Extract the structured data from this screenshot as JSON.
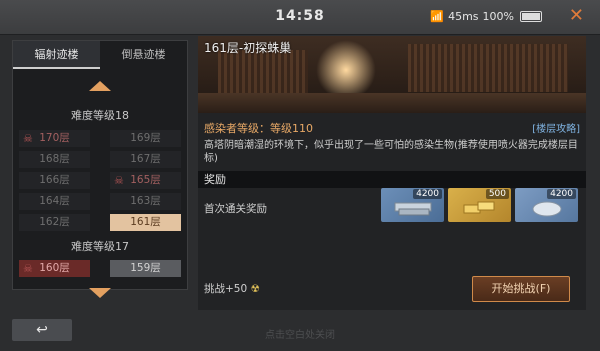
{
  "status_bar": {
    "time": "14:58",
    "network": "45ms",
    "battery": "100%"
  },
  "left": {
    "tabs": [
      "辐射迹楼",
      "倒悬迹楼"
    ],
    "group1": {
      "title": "难度等级18",
      "floors": [
        "170层",
        "169层",
        "168层",
        "167层",
        "166层",
        "165层",
        "164层",
        "163层",
        "162层",
        "161层"
      ]
    },
    "group2": {
      "title": "难度等级17",
      "floors": [
        "160层",
        "159层"
      ]
    }
  },
  "stage": {
    "title": "161层-初探蛛巢",
    "level": "感染者等级：等级110",
    "guide": "[楼层攻略]",
    "description": "高塔阴暗潮湿的环境下，似乎出现了一些可怕的感染生物(推荐使用喷火器完成楼层目标)"
  },
  "reward": {
    "section_title": "奖励",
    "first_clear_label": "首次通关奖励",
    "items": [
      {
        "name": "steel-bars-icon",
        "quantity": "4200"
      },
      {
        "name": "gold-bars-icon",
        "quantity": "500"
      },
      {
        "name": "ore-icon",
        "quantity": "4200"
      }
    ]
  },
  "challenge": {
    "text": "挑战+50",
    "icon": "radiation-icon"
  },
  "actions": {
    "start": "开始挑战(F)",
    "back": "↩"
  },
  "footer_hint": "点击空白处关闭",
  "colors": {
    "accent": "#e3a060",
    "selected": "#e3c3a0",
    "link": "#7fb2e0",
    "close": "#e07b3a"
  }
}
